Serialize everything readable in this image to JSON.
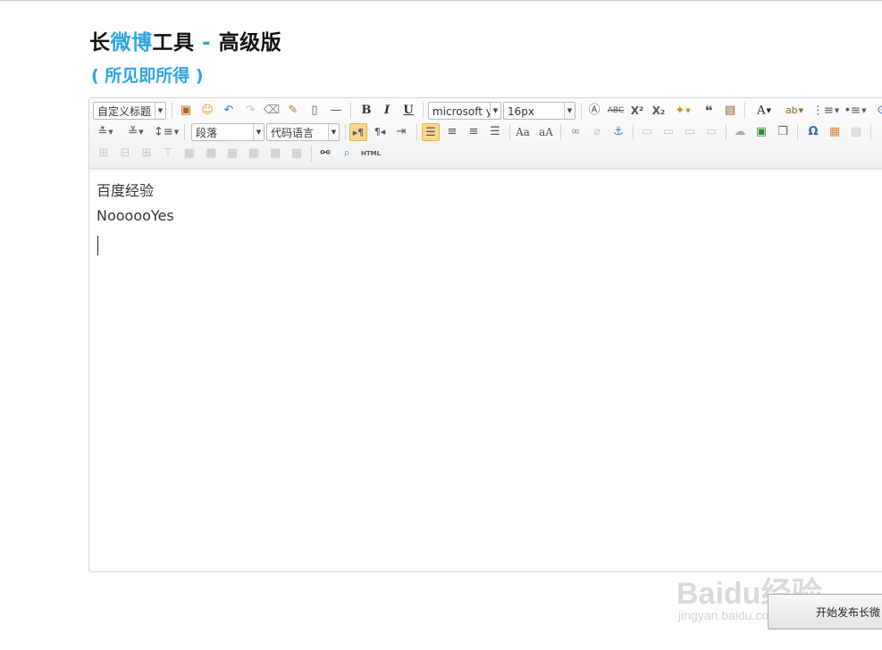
{
  "header": {
    "title_part1": "长",
    "title_part2": "微博",
    "title_part3": "工具",
    "title_sep": " - ",
    "title_part4": "高级版",
    "subtitle": "( 所见即所得 )"
  },
  "toolbar": {
    "custom_heading": "自定义标题",
    "font_family": "microsoft y",
    "font_size": "16px",
    "paragraph": "段落",
    "code_language": "代码语言",
    "bold": "B",
    "italic": "I",
    "underline": "U",
    "html_label": "HTML"
  },
  "editor": {
    "paragraphs": [
      "百度经验",
      "NoooooYes"
    ]
  },
  "publish_button": "开始发布长微",
  "watermark": {
    "logo": "Baidu经验",
    "url": "jingyan.baidu.com"
  },
  "colors": {
    "accent": "#2fa4df",
    "active_button": "#f9d78c"
  }
}
